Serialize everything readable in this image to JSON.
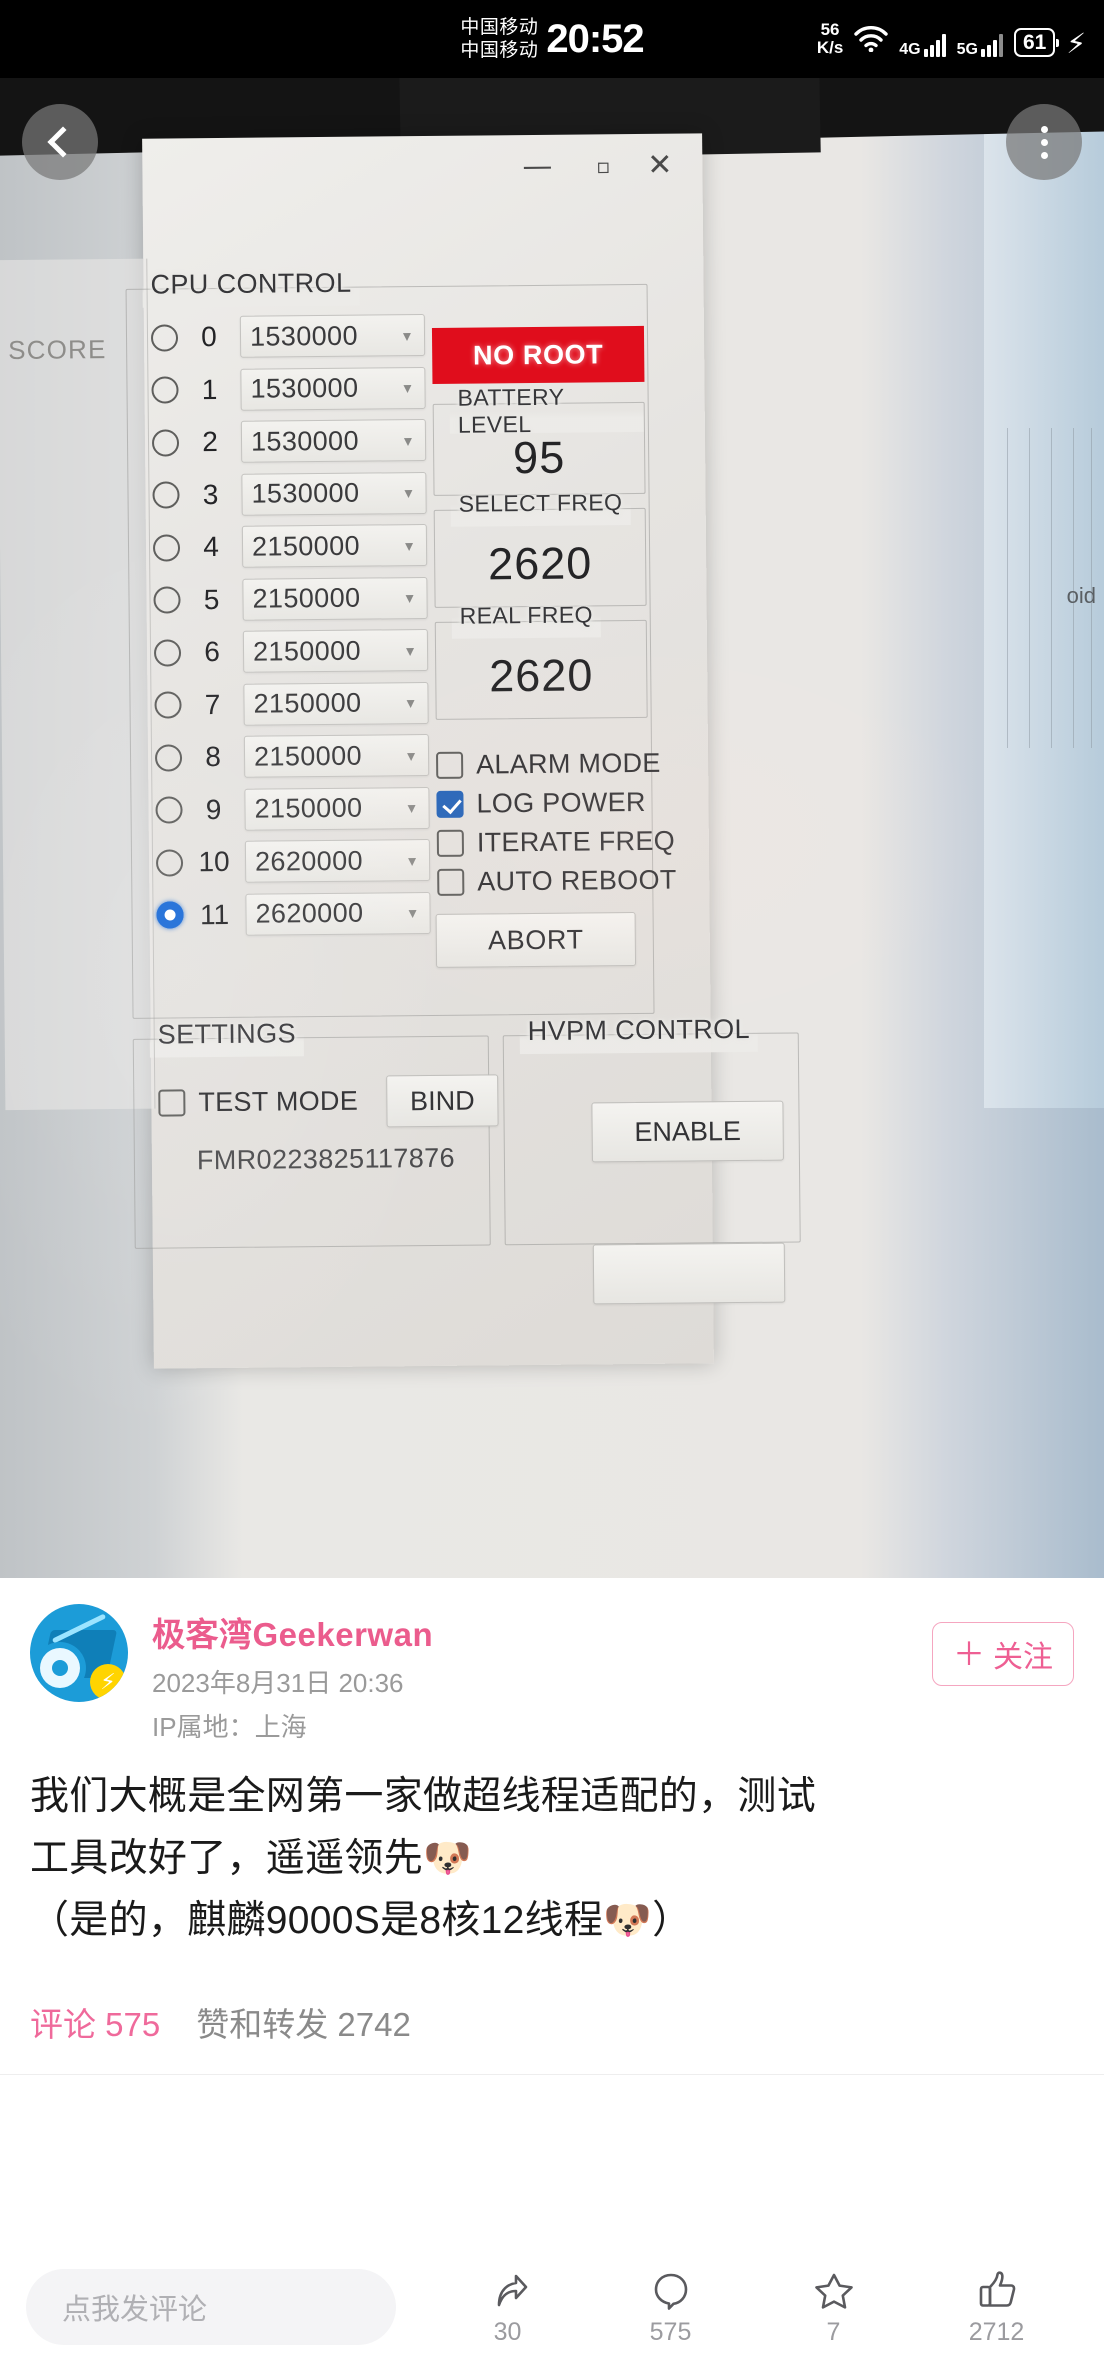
{
  "statusbar": {
    "carrier_line1": "中国移动",
    "carrier_line2": "中国移动",
    "clock": "20:52",
    "net_speed_value": "56",
    "net_speed_unit": "K/s",
    "network_4g": "4G",
    "network_5g": "5G",
    "battery_percent": "61",
    "wifi_icon": "wifi-icon",
    "charging_icon": "charging-bolt-icon"
  },
  "photo_overlay": {
    "back_icon": "back-chevron-icon",
    "more_icon": "more-vertical-icon"
  },
  "app_window": {
    "minimize": "—",
    "maximize": "▫",
    "close": "✕",
    "score_panel_label": "SCORE",
    "cpu_control": {
      "title": "CPU CONTROL",
      "rows": [
        {
          "index": "0",
          "freq": "1530000",
          "selected": false
        },
        {
          "index": "1",
          "freq": "1530000",
          "selected": false
        },
        {
          "index": "2",
          "freq": "1530000",
          "selected": false
        },
        {
          "index": "3",
          "freq": "1530000",
          "selected": false
        },
        {
          "index": "4",
          "freq": "2150000",
          "selected": false
        },
        {
          "index": "5",
          "freq": "2150000",
          "selected": false
        },
        {
          "index": "6",
          "freq": "2150000",
          "selected": false
        },
        {
          "index": "7",
          "freq": "2150000",
          "selected": false
        },
        {
          "index": "8",
          "freq": "2150000",
          "selected": false
        },
        {
          "index": "9",
          "freq": "2150000",
          "selected": false
        },
        {
          "index": "10",
          "freq": "2620000",
          "selected": false
        },
        {
          "index": "11",
          "freq": "2620000",
          "selected": true
        }
      ]
    },
    "status": {
      "no_root_label": "NO ROOT",
      "battery_level_title": "BATTERY LEVEL",
      "battery_level_value": "95",
      "select_freq_title": "SELECT FREQ",
      "select_freq_value": "2620",
      "real_freq_title": "REAL FREQ",
      "real_freq_value": "2620"
    },
    "checkboxes": [
      {
        "label": "ALARM MODE",
        "checked": false
      },
      {
        "label": "LOG POWER",
        "checked": true
      },
      {
        "label": "ITERATE FREQ",
        "checked": false
      },
      {
        "label": "AUTO REBOOT",
        "checked": false
      }
    ],
    "abort_label": "ABORT",
    "settings": {
      "title": "SETTINGS",
      "test_mode_label": "TEST MODE",
      "test_mode_checked": false,
      "bind_label": "BIND",
      "serial": "FMR0223825117876"
    },
    "hvpm": {
      "title": "HVPM CONTROL",
      "enable_label": "ENABLE"
    },
    "background_text": "oid"
  },
  "post": {
    "author": "极客湾Geekerwan",
    "timestamp": "2023年8月31日 20:36",
    "ip_location": "IP属地：上海",
    "follow_label": "关注",
    "follow_plus": "＋",
    "avatar_icon": "geekerwan-avatar-icon",
    "body_lines": [
      "我们大概是全网第一家做超线程适配的，测试",
      "工具改好了，遥遥领先🐶",
      "（是的，麒麟9000S是8核12线程🐶）"
    ],
    "stats": {
      "comments_label": "评论 575",
      "likes_reposts_label": "赞和转发 2742"
    }
  },
  "actionbar": {
    "comment_placeholder": "点我发评论",
    "actions": [
      {
        "icon": "share-icon",
        "count": "30"
      },
      {
        "icon": "comment-icon",
        "count": "575"
      },
      {
        "icon": "star-icon",
        "count": "7"
      },
      {
        "icon": "thumbsup-icon",
        "count": "2712"
      }
    ]
  },
  "colors": {
    "accent_pink": "#ee5f93",
    "no_root_red": "#e00d1c",
    "checkbox_blue": "#2262b8",
    "radio_blue": "#1668d6"
  }
}
